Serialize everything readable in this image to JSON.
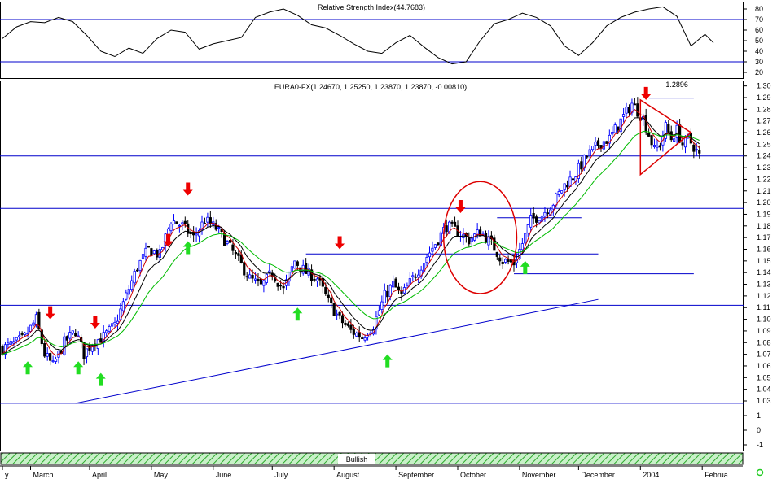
{
  "colors": {
    "background": "#ffffff",
    "frame": "#000000",
    "support_resistance": "#0000cc",
    "bull_candle": "#0000ff",
    "bear_candle": "#000000",
    "ma_fast": "#cc0000",
    "ma_mid": "#000000",
    "ma_slow": "#00bb00",
    "sell_marker": "#ee0000",
    "buy_marker": "#22dd22",
    "pattern": "#dd0000",
    "bullish_fill": "#c8f0c8",
    "bullish_hatch": "#2eaa2e",
    "status_dot": "#22cc22"
  },
  "chart_data": [
    {
      "type": "line",
      "name": "rsi_panel",
      "title": "Relative Strength Index(44.7683)",
      "ylim": [
        14,
        86
      ],
      "y_ticks": [
        20,
        30,
        40,
        50,
        60,
        70,
        80
      ],
      "reference_levels": [
        70,
        30
      ],
      "x": [
        0,
        5,
        10,
        15,
        20,
        25,
        30,
        35,
        40,
        45,
        50,
        55,
        60,
        65,
        70,
        75,
        80,
        85,
        90,
        95,
        100,
        105,
        110,
        115,
        120,
        125,
        130,
        135,
        140,
        145,
        150,
        155,
        160,
        165,
        170,
        175,
        180,
        185,
        190,
        195,
        200,
        205,
        210,
        215,
        220,
        225,
        230,
        235,
        240,
        245,
        250,
        253
      ],
      "values": [
        52,
        63,
        68,
        67,
        72,
        68,
        55,
        40,
        35,
        43,
        38,
        52,
        60,
        58,
        42,
        47,
        50,
        53,
        72,
        77,
        80,
        74,
        65,
        62,
        55,
        47,
        40,
        38,
        48,
        55,
        44,
        34,
        28,
        30,
        50,
        66,
        70,
        76,
        72,
        64,
        45,
        36,
        48,
        64,
        72,
        77,
        80,
        82,
        73,
        45,
        56,
        48
      ]
    },
    {
      "type": "candlestick",
      "name": "price_panel",
      "title": "EURA0-FX(1.24670, 1.25250, 1.23870, 1.23870, -0.00810)",
      "ylim": [
        0.988,
        1.305
      ],
      "y_ticks": [
        "1.30",
        "1.29",
        "1.28",
        "1.27",
        "1.26",
        "1.25",
        "1.24",
        "1.23",
        "1.22",
        "1.21",
        "1.20",
        "1.19",
        "1.18",
        "1.17",
        "1.16",
        "1.15",
        "1.14",
        "1.13",
        "1.12",
        "1.11",
        "1.10",
        "1.09",
        "1.08",
        "1.07",
        "1.06",
        "1.05",
        "1.04",
        "1.03",
        "1",
        "0",
        "-1"
      ],
      "x_tick_labels": [
        {
          "label": "y",
          "x": 0
        },
        {
          "label": "March",
          "x": 10
        },
        {
          "label": "April",
          "x": 31
        },
        {
          "label": "May",
          "x": 53
        },
        {
          "label": "June",
          "x": 75
        },
        {
          "label": "July",
          "x": 96
        },
        {
          "label": "August",
          "x": 118
        },
        {
          "label": "September",
          "x": 140
        },
        {
          "label": "October",
          "x": 162
        },
        {
          "label": "November",
          "x": 184
        },
        {
          "label": "December",
          "x": 205
        },
        {
          "label": "2004",
          "x": 227
        },
        {
          "label": "Februa",
          "x": 249
        }
      ],
      "price_path": {
        "x": [
          0,
          5,
          8,
          12,
          15,
          18,
          22,
          26,
          29,
          32,
          36,
          40,
          44,
          48,
          52,
          56,
          60,
          64,
          68,
          72,
          76,
          80,
          84,
          88,
          92,
          96,
          100,
          104,
          108,
          112,
          116,
          120,
          124,
          128,
          132,
          136,
          139,
          142,
          146,
          150,
          154,
          158,
          162,
          166,
          170,
          174,
          178,
          182,
          185,
          188,
          192,
          196,
          200,
          204,
          208,
          212,
          216,
          220,
          224,
          228,
          232,
          234,
          236,
          238,
          240,
          242,
          244,
          246,
          248
        ],
        "close": [
          1.075,
          1.08,
          1.085,
          1.1,
          1.07,
          1.06,
          1.08,
          1.09,
          1.07,
          1.08,
          1.085,
          1.095,
          1.12,
          1.145,
          1.16,
          1.155,
          1.185,
          1.18,
          1.17,
          1.185,
          1.178,
          1.165,
          1.15,
          1.135,
          1.128,
          1.14,
          1.125,
          1.15,
          1.14,
          1.135,
          1.115,
          1.1,
          1.09,
          1.085,
          1.095,
          1.12,
          1.13,
          1.12,
          1.135,
          1.15,
          1.165,
          1.18,
          1.175,
          1.168,
          1.175,
          1.165,
          1.15,
          1.148,
          1.165,
          1.185,
          1.19,
          1.2,
          1.215,
          1.225,
          1.24,
          1.25,
          1.255,
          1.27,
          1.285,
          1.272,
          1.245,
          1.25,
          1.265,
          1.255,
          1.262,
          1.25,
          1.255,
          1.248,
          1.24
        ]
      },
      "horizontal_lines": [
        1.24,
        1.195,
        1.112,
        1.028
      ],
      "level_segments": [
        {
          "value": 1.2896,
          "x_from": 230,
          "x_to": 246
        },
        {
          "value": 1.187,
          "x_from": 176,
          "x_to": 206
        },
        {
          "value": 1.156,
          "x_from": 108,
          "x_to": 212
        },
        {
          "value": 1.139,
          "x_from": 182,
          "x_to": 246
        }
      ],
      "trendline": {
        "x_from": 26,
        "y_from": 1.028,
        "x_to": 212,
        "y_to": 1.117
      },
      "annotations": [
        {
          "text": "1.2896",
          "x": 236,
          "y": 1.299
        }
      ],
      "sell_signals": [
        {
          "x": 17,
          "y": 1.1
        },
        {
          "x": 33,
          "y": 1.092
        },
        {
          "x": 59,
          "y": 1.162
        },
        {
          "x": 66,
          "y": 1.206
        },
        {
          "x": 120,
          "y": 1.16
        },
        {
          "x": 163,
          "y": 1.191
        },
        {
          "x": 229,
          "y": 1.288
        }
      ],
      "buy_signals": [
        {
          "x": 9,
          "y": 1.064
        },
        {
          "x": 27,
          "y": 1.064
        },
        {
          "x": 35,
          "y": 1.054
        },
        {
          "x": 66,
          "y": 1.167
        },
        {
          "x": 105,
          "y": 1.11
        },
        {
          "x": 137,
          "y": 1.07
        },
        {
          "x": 186,
          "y": 1.15
        }
      ],
      "ellipse": {
        "x_center": 170,
        "y_center": 1.17,
        "x_radius": 13,
        "y_radius": 0.048
      },
      "triangle": [
        {
          "x": 227,
          "y": 1.288
        },
        {
          "x": 245,
          "y": 1.26
        },
        {
          "x": 227,
          "y": 1.224
        }
      ],
      "grid": false,
      "legend": "none"
    }
  ],
  "status_bar": {
    "label": "Bullish"
  }
}
